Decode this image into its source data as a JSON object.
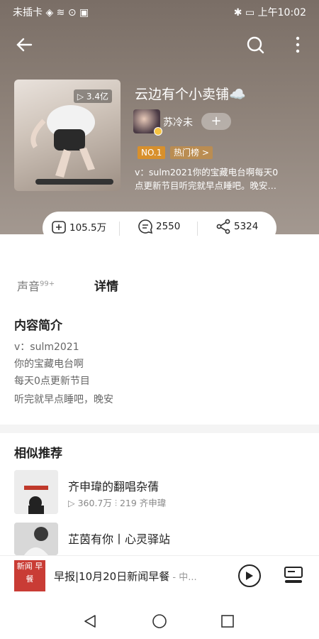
{
  "status_bar": {
    "left": "未插卡 ◈ ≋ ⊙ ▣",
    "right": "✱ ▭ 上午10:02"
  },
  "header": {
    "back_icon": "arrow-left-icon",
    "search_icon": "search-icon",
    "more_icon": "more-vertical-icon"
  },
  "album": {
    "plays": "▷ 3.4亿",
    "title": "云边有个小卖铺☁️",
    "author": "苏冷未",
    "follow_label": "+",
    "tags": [
      "NO.1",
      "热门榜 >"
    ],
    "desc_lines": [
      "v：sulm2021你的宝藏电台啊每天0",
      "点更新节目听完就早点睡吧。晚安…"
    ]
  },
  "stats": {
    "subscribe": "105.5万",
    "comments": "2550",
    "shares": "5324"
  },
  "tabs": {
    "sound": "声音",
    "sound_count": "99+",
    "detail": "详情"
  },
  "intro": {
    "title": "内容简介",
    "lines": [
      "v：sulm2021",
      "你的宝藏电台啊",
      "每天0点更新节目",
      "听完就早点睡吧，晚安"
    ]
  },
  "recommend": {
    "title": "相似推荐",
    "items": [
      {
        "title": "齐申瑋的翻唱杂蒨",
        "meta": "▷ 360.7万   ⫶ 219   齐申瑋"
      },
      {
        "title": "芷茵有你丨心灵驿站",
        "meta": ""
      }
    ]
  },
  "player": {
    "thumb": "新闻 早餐",
    "title": "早报|10月20日新闻早餐",
    "subtitle": " - 中..."
  },
  "colors": {
    "accent": "#d8902c",
    "hero": "#8d8178"
  }
}
